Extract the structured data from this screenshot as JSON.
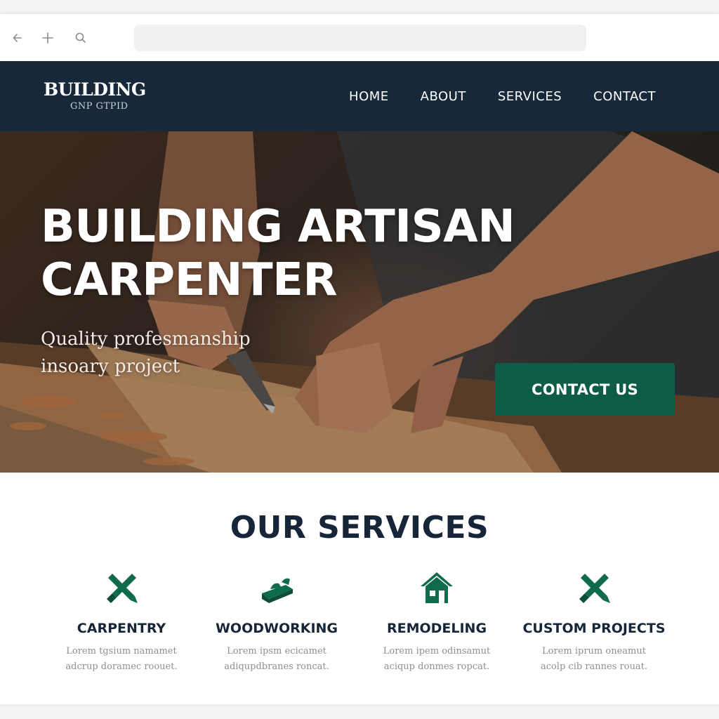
{
  "browser": {
    "back_icon": "arrow-left-icon",
    "newtab_icon": "plus-icon",
    "search_icon": "search-icon",
    "address": ""
  },
  "header": {
    "logo_main": "BUILDING",
    "logo_sub": "GNP GTPID",
    "nav": [
      "HOME",
      "ABOUT",
      "SERVICES",
      "CONTACT"
    ]
  },
  "hero": {
    "title_line1": "BUILDING ARTISAN",
    "title_line2": "CARPENTER",
    "subtitle_line1": "Quality profesmanship",
    "subtitle_line2": "insoary project",
    "cta_label": "CONTACT US"
  },
  "services": {
    "title": "OUR SERVICES",
    "items": [
      {
        "icon": "crossed-tools-icon",
        "name": "CARPENTRY",
        "desc_line1": "Lorem tgsium namamet",
        "desc_line2": "adcrup doramec roouet."
      },
      {
        "icon": "wood-planer-icon",
        "name": "WOODWORKING",
        "desc_line1": "Lorem ipsm ecicamet",
        "desc_line2": "adiqupdbranes roncat."
      },
      {
        "icon": "house-icon",
        "name": "REMODELING",
        "desc_line1": "Lorem ipem odinsamut",
        "desc_line2": "aciqup donmes ropcat."
      },
      {
        "icon": "crossed-tools-icon",
        "name": "CUSTOM PROJECTS",
        "desc_line1": "Lorem iprum oneamut",
        "desc_line2": "acolp cib rannes rouat."
      }
    ]
  },
  "colors": {
    "header_bg": "#16283a",
    "accent_green": "#0c5c46",
    "icon_green": "#0f6b4c",
    "heading_navy": "#162638"
  }
}
